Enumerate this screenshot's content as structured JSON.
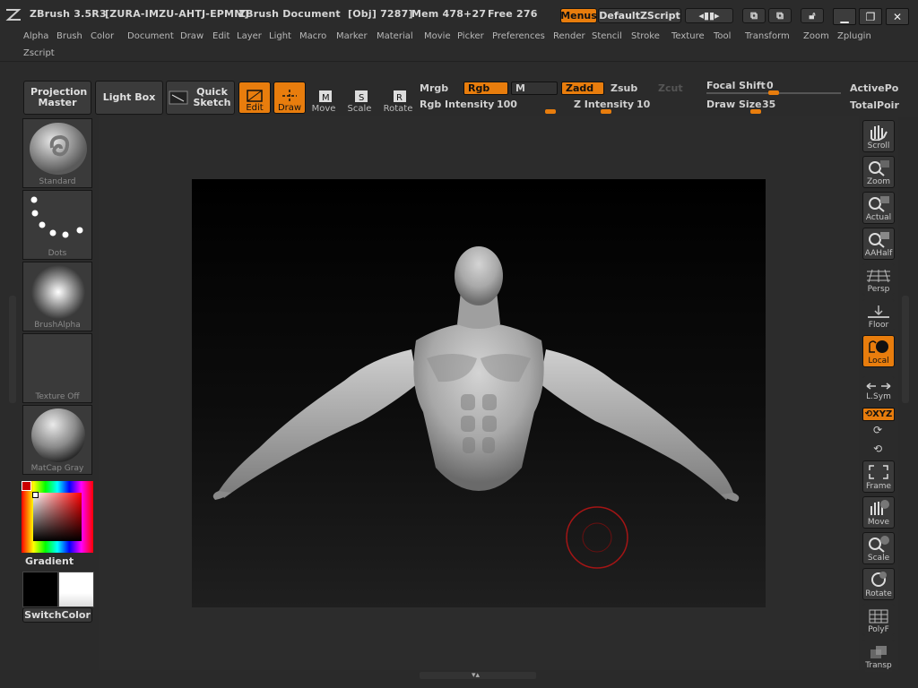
{
  "titlebar": {
    "app": "ZBrush 3.5R3",
    "serial": "[ZURA-IMZU-AHTJ-EPMM]",
    "doc": "ZBrush Document",
    "obj": "[Obj] 7287]",
    "mem": "Mem 478+27",
    "free": "Free 276",
    "menus_btn": "Menus",
    "script_btn": "DefaultZScript"
  },
  "menus": [
    "Alpha",
    "Brush",
    "Color",
    "Document",
    "Draw",
    "Edit",
    "Layer",
    "Light",
    "Macro",
    "Marker",
    "Material",
    "Movie",
    "Picker",
    "Preferences",
    "Render",
    "Stencil",
    "Stroke",
    "Texture",
    "Tool",
    "Transform",
    "Zoom",
    "Zplugin",
    "Zscript"
  ],
  "shelf": {
    "projection_master": "Projection Master",
    "light_box": "Light Box",
    "quick_sketch": "Quick Sketch",
    "tools": [
      "Edit",
      "Draw",
      "Move",
      "Scale",
      "Rotate"
    ],
    "mrgb": "Mrgb",
    "rgb": "Rgb",
    "m": "M",
    "zadd": "Zadd",
    "zsub": "Zsub",
    "zcut": "Zcut",
    "rgb_intensity_label": "Rgb Intensity",
    "rgb_intensity": "100",
    "z_intensity_label": "Z Intensity",
    "z_intensity": "10",
    "focal_shift_label": "Focal Shift",
    "focal_shift": "0",
    "draw_size_label": "Draw Size",
    "draw_size": "35",
    "active_points": "ActivePo",
    "total_points": "TotalPoir"
  },
  "left_panel": {
    "brush": "Standard",
    "stroke": "Dots",
    "alpha": "BrushAlpha",
    "texture": "Texture Off",
    "material": "MatCap Gray",
    "gradient": "Gradient",
    "switch_color": "SwitchColor"
  },
  "right_panel": [
    "Scroll",
    "Zoom",
    "Actual",
    "AAHalf",
    "Persp",
    "Floor",
    "Local",
    "L.Sym",
    "Frame",
    "Move",
    "Scale",
    "Rotate",
    "PolyF",
    "Transp"
  ],
  "xyz": "XYZ",
  "colors": {
    "accent": "#e87d0d",
    "panel": "#2b2b2b",
    "button": "#3a3a3a"
  }
}
